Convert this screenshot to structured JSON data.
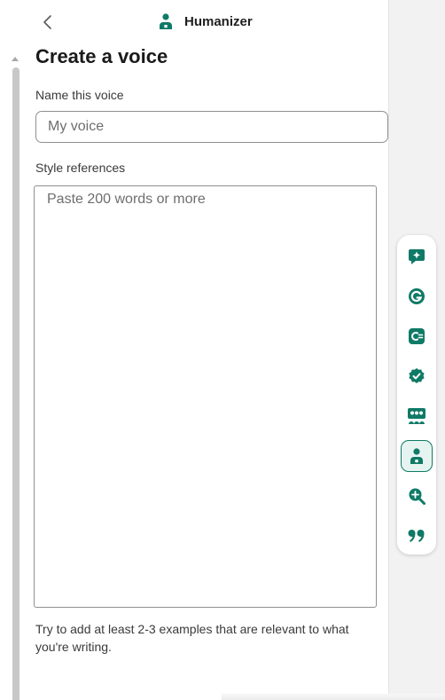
{
  "header": {
    "title": "Humanizer",
    "back_icon": "chevron-left-icon",
    "title_icon": "person-icon"
  },
  "page": {
    "title": "Create a voice"
  },
  "form": {
    "name_label": "Name this voice",
    "name_placeholder": "My voice",
    "name_value": "",
    "style_label": "Style references",
    "style_placeholder": "Paste 200 words or more",
    "style_value": "",
    "hint": "Try to add at least 2-3 examples that are relevant to what you're writing."
  },
  "rail": {
    "items": [
      {
        "name": "ai-chat-icon",
        "active": false
      },
      {
        "name": "grammarly-icon",
        "active": false
      },
      {
        "name": "paraphrase-icon",
        "active": false
      },
      {
        "name": "verified-check-icon",
        "active": false
      },
      {
        "name": "audience-icon",
        "active": false
      },
      {
        "name": "humanizer-person-icon",
        "active": true
      },
      {
        "name": "search-plus-icon",
        "active": false
      },
      {
        "name": "quote-icon",
        "active": false
      }
    ]
  },
  "colors": {
    "accent": "#0f7a66",
    "accent_light": "#e6f4f1",
    "border": "#8f8f8f",
    "muted_text": "#6e6e6e"
  }
}
